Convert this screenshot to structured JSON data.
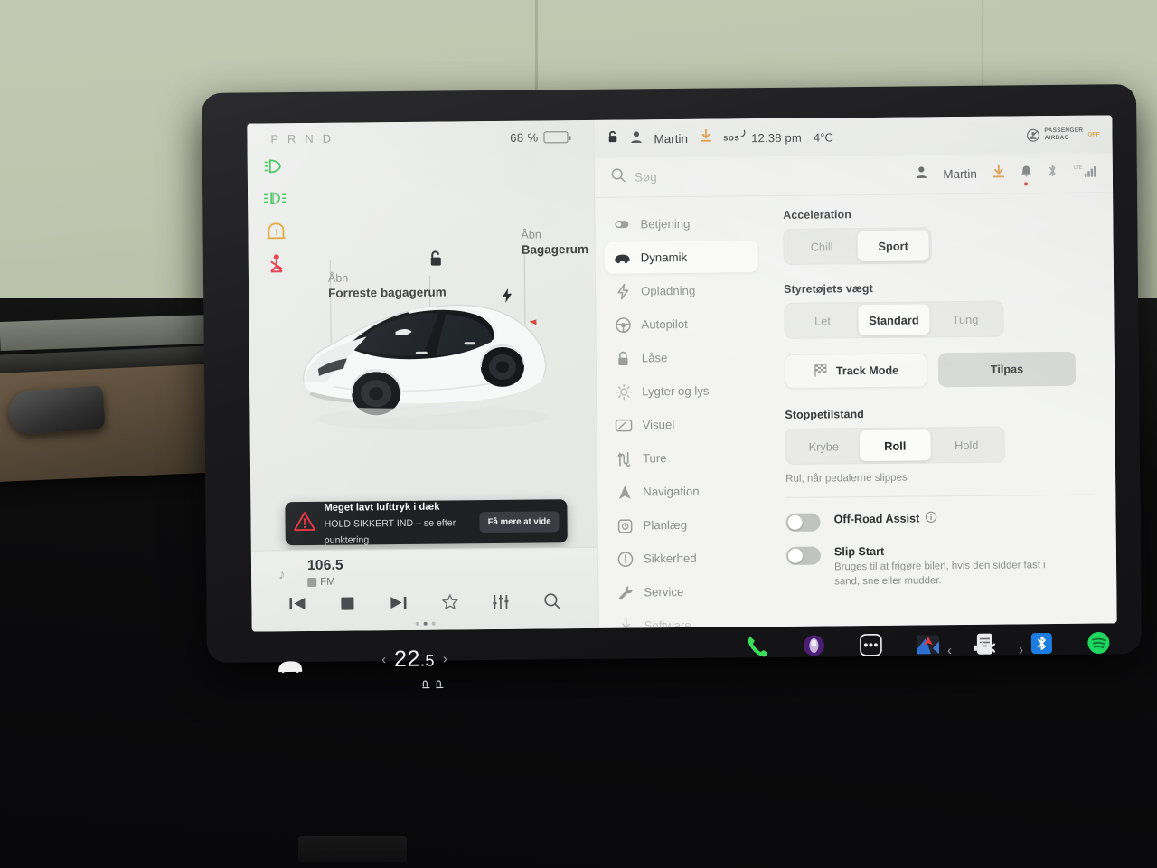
{
  "left_panel": {
    "gear_indicator": "P R N D",
    "battery_percent": "68 %",
    "battery_level": 68,
    "telltales": [
      {
        "name": "headlight-telltale",
        "color": "#2fbf4a"
      },
      {
        "name": "fog-light-telltale",
        "color": "#2fbf4a"
      },
      {
        "name": "tire-pressure-telltale",
        "color": "#e0a12b"
      },
      {
        "name": "seatbelt-telltale",
        "color": "#e0303f"
      }
    ],
    "front_trunk": {
      "action": "Åbn",
      "target": "Forreste bagagerum"
    },
    "rear_trunk": {
      "action": "Åbn",
      "target": "Bagagerum"
    },
    "lock_icon": "unlock-icon",
    "charge_port_icon": "charge-bolt-icon",
    "alert": {
      "icon": "warning-triangle-icon",
      "title": "Meget lavt lufttryk i dæk",
      "subtitle": "HOLD SIKKERT IND – se efter punktering",
      "button": "Få mere at vide",
      "accent": "#e0303f"
    },
    "media": {
      "station": "106.5",
      "band": "FM",
      "controls": [
        "previous-icon",
        "stop-icon",
        "next-icon",
        "favorite-star-icon",
        "equalizer-icon",
        "search-icon"
      ],
      "page_dots": 3,
      "active_dot": 1
    }
  },
  "status_bar": {
    "lock_icon": "unlock-icon",
    "profile_icon": "person-icon",
    "profile_name": "Martin",
    "download_icon": "software-update-icon",
    "sos_label": "sos",
    "time": "12.38 pm",
    "temperature": "4°C",
    "airbag": {
      "line1": "PASSENGER",
      "line2": "AIRBAG",
      "state": "OFF"
    }
  },
  "search": {
    "icon": "search-icon",
    "placeholder": "Søg",
    "profile_name": "Martin",
    "icons": [
      "software-update-icon",
      "notification-bell-icon",
      "bluetooth-icon",
      "lte-signal-icon"
    ],
    "lte_label": "LTE"
  },
  "menu": {
    "items": [
      {
        "label": "Betjening",
        "icon": "toggle-icon",
        "state": "normal"
      },
      {
        "label": "Dynamik",
        "icon": "car-icon",
        "state": "active"
      },
      {
        "label": "Opladning",
        "icon": "bolt-icon",
        "state": "normal"
      },
      {
        "label": "Autopilot",
        "icon": "steering-wheel-icon",
        "state": "normal"
      },
      {
        "label": "Låse",
        "icon": "lock-icon",
        "state": "normal"
      },
      {
        "label": "Lygter og lys",
        "icon": "brightness-icon",
        "state": "normal"
      },
      {
        "label": "Visuel",
        "icon": "display-icon",
        "state": "normal"
      },
      {
        "label": "Ture",
        "icon": "trip-icon",
        "state": "normal"
      },
      {
        "label": "Navigation",
        "icon": "navigation-arrow-icon",
        "state": "normal"
      },
      {
        "label": "Planlæg",
        "icon": "schedule-clock-icon",
        "state": "normal"
      },
      {
        "label": "Sikkerhed",
        "icon": "safety-alert-icon",
        "state": "normal"
      },
      {
        "label": "Service",
        "icon": "wrench-icon",
        "state": "normal"
      },
      {
        "label": "Software",
        "icon": "software-icon",
        "state": "faded"
      }
    ]
  },
  "settings": {
    "acceleration": {
      "title": "Acceleration",
      "options": [
        "Chill",
        "Sport"
      ],
      "selected": "Sport"
    },
    "steering": {
      "title": "Styretøjets vægt",
      "options": [
        "Let",
        "Standard",
        "Tung"
      ],
      "selected": "Standard"
    },
    "buttons": {
      "track_mode": "Track Mode",
      "track_mode_icon": "checkered-flag-icon",
      "customize": "Tilpas"
    },
    "stopping_mode": {
      "title": "Stoppetilstand",
      "options": [
        "Krybe",
        "Roll",
        "Hold"
      ],
      "selected": "Roll",
      "hint": "Rul, når pedalerne slippes"
    },
    "toggles": [
      {
        "label": "Off-Road Assist",
        "info_icon": "info-icon",
        "state": "off",
        "description": ""
      },
      {
        "label": "Slip Start",
        "info_icon": "",
        "state": "off",
        "description": "Bruges til at frigøre bilen, hvis den sidder fast i sand, sne eller mudder."
      }
    ]
  },
  "dock": {
    "car_icon": "car-front-icon",
    "climate_value": "22",
    "climate_decimal": ".5",
    "chevron_left": "‹",
    "chevron_right": "›",
    "seat_icons": [
      "driver-seat-heater-icon",
      "passenger-seat-heater-icon"
    ],
    "apps": [
      {
        "name": "phone-icon",
        "color": "#3ddc5c"
      },
      {
        "name": "voice-assistant-icon",
        "color": "#7a3fb8"
      },
      {
        "name": "more-apps-icon",
        "color": "#f2f2f2"
      },
      {
        "name": "navigation-app-icon",
        "color": "#2b6fd6"
      },
      {
        "name": "info-card-icon",
        "color": "#e8e8e8"
      },
      {
        "name": "bluetooth-app-icon",
        "color": "#1d7ce0"
      },
      {
        "name": "spotify-icon",
        "color": "#1ed760"
      }
    ],
    "volume_icon": "volume-muted-icon"
  }
}
